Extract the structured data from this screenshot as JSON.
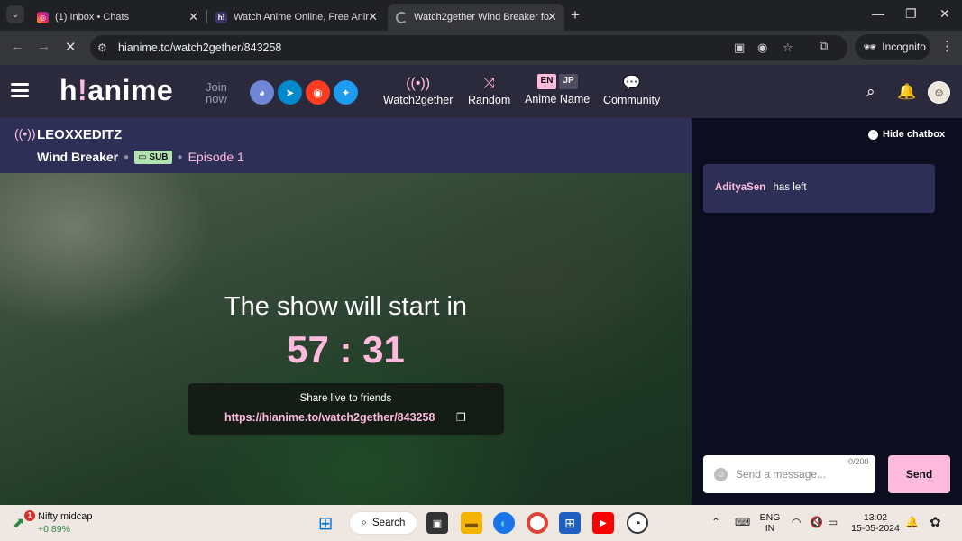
{
  "browser": {
    "tabs": [
      {
        "label": "(1) Inbox • Chats",
        "favicon": "instagram-icon"
      },
      {
        "label": "Watch Anime Online, Free Anim",
        "favicon": "hianime-icon"
      },
      {
        "label": "Watch2gether Wind Breaker fo",
        "favicon": "loading-icon",
        "active": true
      }
    ],
    "url": "hianime.to/watch2gether/843258",
    "incognito_label": "Incognito"
  },
  "site": {
    "logo_main": "h",
    "logo_bang": "!",
    "logo_rest": "anime",
    "join_line1": "Join",
    "join_line2": "now",
    "socials": [
      "discord-icon",
      "telegram-icon",
      "reddit-icon",
      "twitter-icon"
    ],
    "nav": {
      "watch2gether": "Watch2gether",
      "random": "Random",
      "anime_name": "Anime Name",
      "lang_en": "EN",
      "lang_jp": "JP",
      "community": "Community"
    }
  },
  "room": {
    "host": "LEOXXEDITZ",
    "anime": "Wind Breaker",
    "badge": "SUB",
    "episode": "Episode 1"
  },
  "stage": {
    "heading": "The show will start in",
    "countdown": "57 : 31",
    "share_label": "Share live to friends",
    "share_link": "https://hianime.to/watch2gether/843258"
  },
  "chat": {
    "hide_label": "Hide chatbox",
    "messages": [
      {
        "user": "AdityaSen",
        "text": "has left"
      }
    ],
    "counter": "0/200",
    "placeholder": "Send a message...",
    "send_label": "Send"
  },
  "taskbar": {
    "stock_name": "Nifty midcap",
    "stock_change": "+0.89%",
    "stock_badge": "1",
    "search_label": "Search",
    "lang_line1": "ENG",
    "lang_line2": "IN",
    "time": "13:02",
    "date": "15-05-2024"
  },
  "colors": {
    "accent_pink": "#ffbade",
    "header_bg": "#2b2a3d",
    "roombar_bg": "#2d2f56",
    "chat_bg": "#0c0e1f"
  }
}
